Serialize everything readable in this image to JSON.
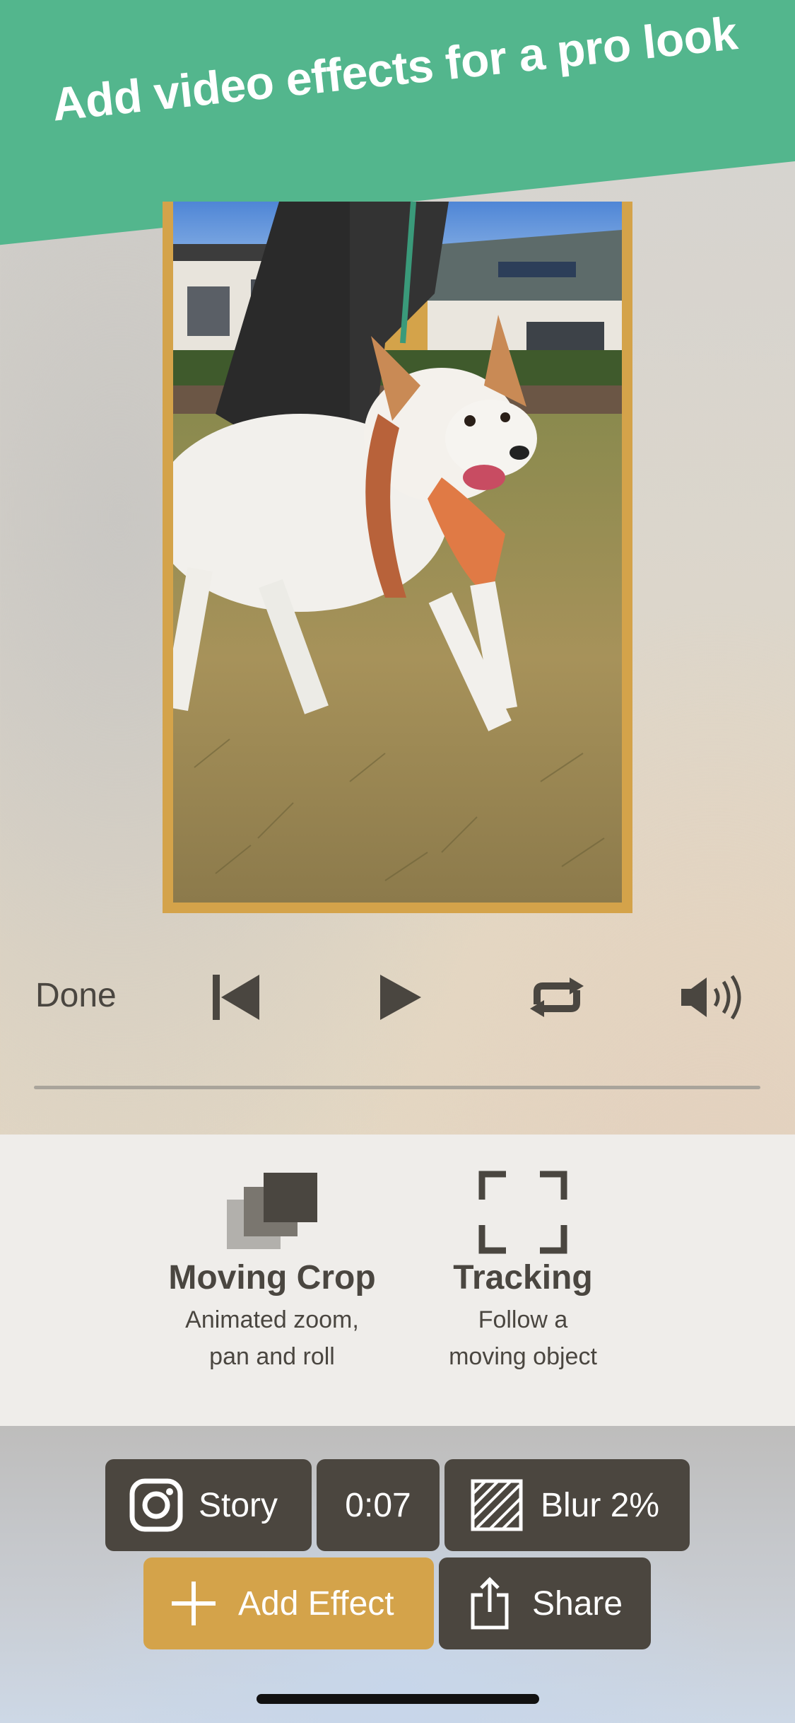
{
  "banner": {
    "text": "Add video effects for a pro look",
    "color": "#53b68d"
  },
  "controls": {
    "done_label": "Done",
    "icons": [
      "skip-to-start-icon",
      "play-icon",
      "loop-icon",
      "volume-icon"
    ]
  },
  "effects": [
    {
      "title": "Moving Crop",
      "desc_line1": "Animated zoom,",
      "desc_line2": "pan and roll",
      "icon": "layers-icon"
    },
    {
      "title": "Tracking",
      "desc_line1": "Follow a",
      "desc_line2": "moving object",
      "icon": "viewfinder-icon"
    }
  ],
  "toolbar": {
    "story_label": "Story",
    "duration": "0:07",
    "blur_label": "Blur 2%",
    "add_effect_label": "Add Effect",
    "share_label": "Share"
  },
  "colors": {
    "accent": "#d4a34a",
    "dark": "#4b463f",
    "banner": "#53b68d"
  }
}
